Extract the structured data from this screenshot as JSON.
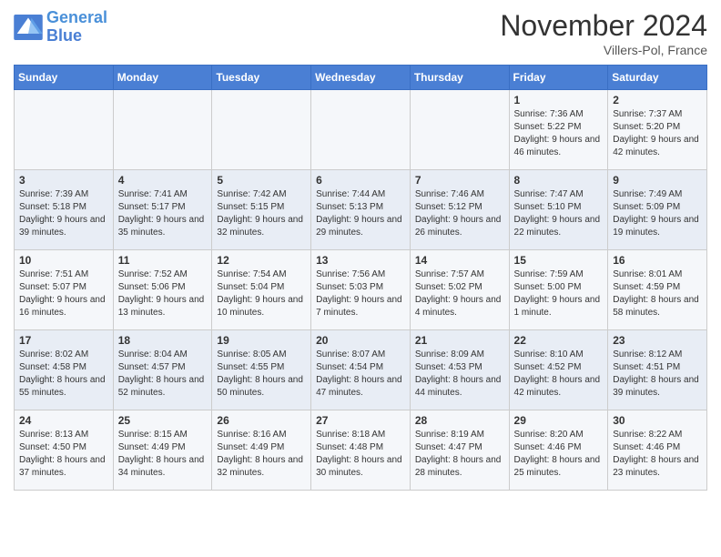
{
  "logo": {
    "line1": "General",
    "line2": "Blue"
  },
  "header": {
    "month": "November 2024",
    "location": "Villers-Pol, France"
  },
  "days_of_week": [
    "Sunday",
    "Monday",
    "Tuesday",
    "Wednesday",
    "Thursday",
    "Friday",
    "Saturday"
  ],
  "weeks": [
    [
      {
        "day": "",
        "sunrise": "",
        "sunset": "",
        "daylight": ""
      },
      {
        "day": "",
        "sunrise": "",
        "sunset": "",
        "daylight": ""
      },
      {
        "day": "",
        "sunrise": "",
        "sunset": "",
        "daylight": ""
      },
      {
        "day": "",
        "sunrise": "",
        "sunset": "",
        "daylight": ""
      },
      {
        "day": "",
        "sunrise": "",
        "sunset": "",
        "daylight": ""
      },
      {
        "day": "1",
        "sunrise": "Sunrise: 7:36 AM",
        "sunset": "Sunset: 5:22 PM",
        "daylight": "Daylight: 9 hours and 46 minutes."
      },
      {
        "day": "2",
        "sunrise": "Sunrise: 7:37 AM",
        "sunset": "Sunset: 5:20 PM",
        "daylight": "Daylight: 9 hours and 42 minutes."
      }
    ],
    [
      {
        "day": "3",
        "sunrise": "Sunrise: 7:39 AM",
        "sunset": "Sunset: 5:18 PM",
        "daylight": "Daylight: 9 hours and 39 minutes."
      },
      {
        "day": "4",
        "sunrise": "Sunrise: 7:41 AM",
        "sunset": "Sunset: 5:17 PM",
        "daylight": "Daylight: 9 hours and 35 minutes."
      },
      {
        "day": "5",
        "sunrise": "Sunrise: 7:42 AM",
        "sunset": "Sunset: 5:15 PM",
        "daylight": "Daylight: 9 hours and 32 minutes."
      },
      {
        "day": "6",
        "sunrise": "Sunrise: 7:44 AM",
        "sunset": "Sunset: 5:13 PM",
        "daylight": "Daylight: 9 hours and 29 minutes."
      },
      {
        "day": "7",
        "sunrise": "Sunrise: 7:46 AM",
        "sunset": "Sunset: 5:12 PM",
        "daylight": "Daylight: 9 hours and 26 minutes."
      },
      {
        "day": "8",
        "sunrise": "Sunrise: 7:47 AM",
        "sunset": "Sunset: 5:10 PM",
        "daylight": "Daylight: 9 hours and 22 minutes."
      },
      {
        "day": "9",
        "sunrise": "Sunrise: 7:49 AM",
        "sunset": "Sunset: 5:09 PM",
        "daylight": "Daylight: 9 hours and 19 minutes."
      }
    ],
    [
      {
        "day": "10",
        "sunrise": "Sunrise: 7:51 AM",
        "sunset": "Sunset: 5:07 PM",
        "daylight": "Daylight: 9 hours and 16 minutes."
      },
      {
        "day": "11",
        "sunrise": "Sunrise: 7:52 AM",
        "sunset": "Sunset: 5:06 PM",
        "daylight": "Daylight: 9 hours and 13 minutes."
      },
      {
        "day": "12",
        "sunrise": "Sunrise: 7:54 AM",
        "sunset": "Sunset: 5:04 PM",
        "daylight": "Daylight: 9 hours and 10 minutes."
      },
      {
        "day": "13",
        "sunrise": "Sunrise: 7:56 AM",
        "sunset": "Sunset: 5:03 PM",
        "daylight": "Daylight: 9 hours and 7 minutes."
      },
      {
        "day": "14",
        "sunrise": "Sunrise: 7:57 AM",
        "sunset": "Sunset: 5:02 PM",
        "daylight": "Daylight: 9 hours and 4 minutes."
      },
      {
        "day": "15",
        "sunrise": "Sunrise: 7:59 AM",
        "sunset": "Sunset: 5:00 PM",
        "daylight": "Daylight: 9 hours and 1 minute."
      },
      {
        "day": "16",
        "sunrise": "Sunrise: 8:01 AM",
        "sunset": "Sunset: 4:59 PM",
        "daylight": "Daylight: 8 hours and 58 minutes."
      }
    ],
    [
      {
        "day": "17",
        "sunrise": "Sunrise: 8:02 AM",
        "sunset": "Sunset: 4:58 PM",
        "daylight": "Daylight: 8 hours and 55 minutes."
      },
      {
        "day": "18",
        "sunrise": "Sunrise: 8:04 AM",
        "sunset": "Sunset: 4:57 PM",
        "daylight": "Daylight: 8 hours and 52 minutes."
      },
      {
        "day": "19",
        "sunrise": "Sunrise: 8:05 AM",
        "sunset": "Sunset: 4:55 PM",
        "daylight": "Daylight: 8 hours and 50 minutes."
      },
      {
        "day": "20",
        "sunrise": "Sunrise: 8:07 AM",
        "sunset": "Sunset: 4:54 PM",
        "daylight": "Daylight: 8 hours and 47 minutes."
      },
      {
        "day": "21",
        "sunrise": "Sunrise: 8:09 AM",
        "sunset": "Sunset: 4:53 PM",
        "daylight": "Daylight: 8 hours and 44 minutes."
      },
      {
        "day": "22",
        "sunrise": "Sunrise: 8:10 AM",
        "sunset": "Sunset: 4:52 PM",
        "daylight": "Daylight: 8 hours and 42 minutes."
      },
      {
        "day": "23",
        "sunrise": "Sunrise: 8:12 AM",
        "sunset": "Sunset: 4:51 PM",
        "daylight": "Daylight: 8 hours and 39 minutes."
      }
    ],
    [
      {
        "day": "24",
        "sunrise": "Sunrise: 8:13 AM",
        "sunset": "Sunset: 4:50 PM",
        "daylight": "Daylight: 8 hours and 37 minutes."
      },
      {
        "day": "25",
        "sunrise": "Sunrise: 8:15 AM",
        "sunset": "Sunset: 4:49 PM",
        "daylight": "Daylight: 8 hours and 34 minutes."
      },
      {
        "day": "26",
        "sunrise": "Sunrise: 8:16 AM",
        "sunset": "Sunset: 4:49 PM",
        "daylight": "Daylight: 8 hours and 32 minutes."
      },
      {
        "day": "27",
        "sunrise": "Sunrise: 8:18 AM",
        "sunset": "Sunset: 4:48 PM",
        "daylight": "Daylight: 8 hours and 30 minutes."
      },
      {
        "day": "28",
        "sunrise": "Sunrise: 8:19 AM",
        "sunset": "Sunset: 4:47 PM",
        "daylight": "Daylight: 8 hours and 28 minutes."
      },
      {
        "day": "29",
        "sunrise": "Sunrise: 8:20 AM",
        "sunset": "Sunset: 4:46 PM",
        "daylight": "Daylight: 8 hours and 25 minutes."
      },
      {
        "day": "30",
        "sunrise": "Sunrise: 8:22 AM",
        "sunset": "Sunset: 4:46 PM",
        "daylight": "Daylight: 8 hours and 23 minutes."
      }
    ]
  ]
}
